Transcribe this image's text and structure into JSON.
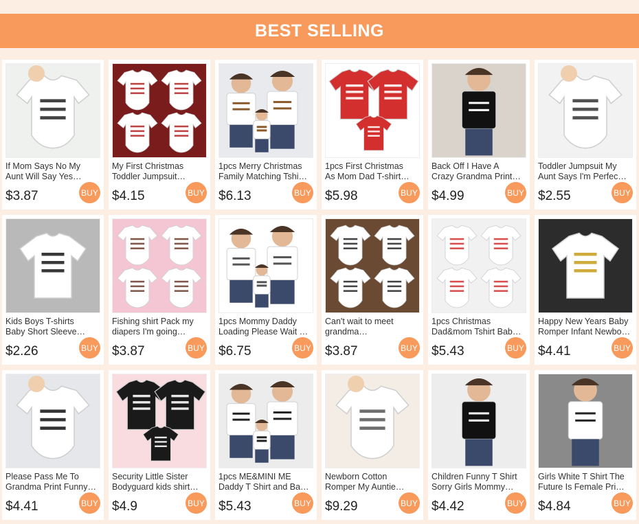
{
  "banner": {
    "title": "BEST SELLING",
    "color": "#f79a5c"
  },
  "products": [
    {
      "title_lines": [
        "If Mom Says No My",
        "Aunt Will Say Yes…"
      ],
      "price": "$3.87",
      "buy": "BUY",
      "scene": "baby-onesie",
      "bg": "#eef1ee",
      "shirt": "#ffffff",
      "text": "#222222"
    },
    {
      "title_lines": [
        "My First Christmas",
        "Toddler Jumpsuit…"
      ],
      "price": "$4.15",
      "buy": "BUY",
      "scene": "christmas-onesies",
      "bg": "#7a1c1c",
      "shirt": "#ffffff",
      "text": "#b22222"
    },
    {
      "title_lines": [
        "1pcs Merry Christmas",
        "Family Matching Tshi…"
      ],
      "price": "$6.13",
      "buy": "BUY",
      "scene": "family",
      "bg": "#e9eaee",
      "shirt": "#ffffff",
      "text": "#8b5a2b"
    },
    {
      "title_lines": [
        "1pcs First Christmas",
        "As Mom Dad T-shirt…"
      ],
      "price": "$5.98",
      "buy": "BUY",
      "scene": "red-shirts",
      "bg": "#ffffff",
      "shirt": "#d32f2f",
      "text": "#ffffff"
    },
    {
      "title_lines": [
        "Back Off I Have A",
        "Crazy Grandma Print…"
      ],
      "price": "$4.99",
      "buy": "BUY",
      "scene": "kid-black",
      "bg": "#d9d3cc",
      "shirt": "#111111",
      "text": "#ffffff"
    },
    {
      "title_lines": [
        "Toddler Jumpsuit My",
        "Aunt Says I'm Perfec…"
      ],
      "price": "$2.55",
      "buy": "BUY",
      "scene": "baby-onesie",
      "bg": "#f2f2f2",
      "shirt": "#ffffff",
      "text": "#333333"
    },
    {
      "title_lines": [
        "Kids Boys T-shirts",
        "Baby Short Sleeve…"
      ],
      "price": "$2.26",
      "buy": "BUY",
      "scene": "flat-shirt",
      "bg": "#b9b9b9",
      "shirt": "#ffffff",
      "text": "#222222"
    },
    {
      "title_lines": [
        "Fishing shirt Pack my",
        "diapers I'm going…"
      ],
      "price": "$3.87",
      "buy": "BUY",
      "scene": "christmas-onesies",
      "bg": "#f4c6d3",
      "shirt": "#ffffff",
      "text": "#6b3a2a"
    },
    {
      "title_lines": [
        "1pcs Mommy Daddy",
        "Loading Please Wait …"
      ],
      "price": "$6.75",
      "buy": "BUY",
      "scene": "family",
      "bg": "#ffffff",
      "shirt": "#ffffff",
      "text": "#555555"
    },
    {
      "title_lines": [
        "Can't wait to meet",
        "grandma…"
      ],
      "price": "$3.87",
      "buy": "BUY",
      "scene": "christmas-onesies",
      "bg": "#6b4a33",
      "shirt": "#ffffff",
      "text": "#222222"
    },
    {
      "title_lines": [
        "1pcs Christmas",
        "Dad&mom Tshirt Bab…"
      ],
      "price": "$5.43",
      "buy": "BUY",
      "scene": "christmas-onesies",
      "bg": "#f1f1f1",
      "shirt": "#ffffff",
      "text": "#d32f2f"
    },
    {
      "title_lines": [
        "Happy New Years Baby",
        "Romper Infant Newbo…"
      ],
      "price": "$4.41",
      "buy": "BUY",
      "scene": "flat-shirt",
      "bg": "#2c2c2c",
      "shirt": "#ffffff",
      "text": "#c9a227"
    },
    {
      "title_lines": [
        "Please Pass Me To",
        "Grandma Print Funny…"
      ],
      "price": "$4.41",
      "buy": "BUY",
      "scene": "baby-onesie",
      "bg": "#e5e7ea",
      "shirt": "#ffffff",
      "text": "#111111"
    },
    {
      "title_lines": [
        "Security Little Sister",
        "Bodyguard kids shirt…"
      ],
      "price": "$4.9",
      "buy": "BUY",
      "scene": "red-shirts",
      "bg": "#f8dcdf",
      "shirt": "#1a1a1a",
      "text": "#ffffff"
    },
    {
      "title_lines": [
        "1pcs ME&MINI ME",
        "Daddy T Shirt and Ba…"
      ],
      "price": "$5.43",
      "buy": "BUY",
      "scene": "family",
      "bg": "#ececec",
      "shirt": "#ffffff",
      "text": "#222222"
    },
    {
      "title_lines": [
        "Newborn Cotton",
        "Romper My Auntie…"
      ],
      "price": "$9.29",
      "buy": "BUY",
      "scene": "baby-onesie",
      "bg": "#f4ede6",
      "shirt": "#ffffff",
      "text": "#555555"
    },
    {
      "title_lines": [
        "Children Funny T Shirt",
        "Sorry Girls Mommy…"
      ],
      "price": "$4.42",
      "buy": "BUY",
      "scene": "kid-black",
      "bg": "#ededed",
      "shirt": "#111111",
      "text": "#ffffff"
    },
    {
      "title_lines": [
        "Girls White T Shirt The",
        "Future Is Female Pri…"
      ],
      "price": "$4.84",
      "buy": "BUY",
      "scene": "kid-black",
      "bg": "#8a8a8a",
      "shirt": "#ffffff",
      "text": "#222222"
    }
  ]
}
